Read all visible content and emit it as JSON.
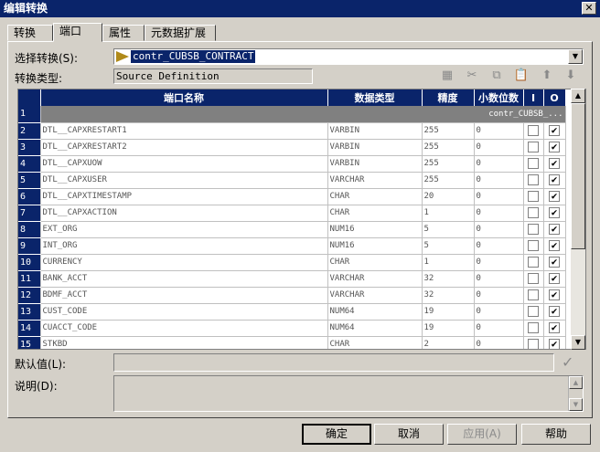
{
  "window": {
    "title": "编辑转换",
    "close_label": "✕"
  },
  "tabs": [
    {
      "label": "转换"
    },
    {
      "label": "端口"
    },
    {
      "label": "属性"
    },
    {
      "label": "元数据扩展"
    }
  ],
  "select_transform": {
    "label": "选择转换(S):",
    "value": "contr_CUBSB_CONTRACT"
  },
  "transform_type": {
    "label": "转换类型:",
    "value": "Source Definition"
  },
  "grid": {
    "headers": {
      "name": "端口名称",
      "datatype": "数据类型",
      "precision": "精度",
      "scale": "小数位数",
      "input": "I",
      "output": "O"
    },
    "group_row": {
      "num": "1",
      "text": "contr_CUBSB_..."
    },
    "rows": [
      {
        "num": "2",
        "name": "DTL__CAPXRESTART1",
        "type": "VARBIN",
        "prec": "255",
        "scale": "0",
        "i": false,
        "o": true
      },
      {
        "num": "3",
        "name": "DTL__CAPXRESTART2",
        "type": "VARBIN",
        "prec": "255",
        "scale": "0",
        "i": false,
        "o": true
      },
      {
        "num": "4",
        "name": "DTL__CAPXUOW",
        "type": "VARBIN",
        "prec": "255",
        "scale": "0",
        "i": false,
        "o": true
      },
      {
        "num": "5",
        "name": "DTL__CAPXUSER",
        "type": "VARCHAR",
        "prec": "255",
        "scale": "0",
        "i": false,
        "o": true
      },
      {
        "num": "6",
        "name": "DTL__CAPXTIMESTAMP",
        "type": "CHAR",
        "prec": "20",
        "scale": "0",
        "i": false,
        "o": true
      },
      {
        "num": "7",
        "name": "DTL__CAPXACTION",
        "type": "CHAR",
        "prec": "1",
        "scale": "0",
        "i": false,
        "o": true
      },
      {
        "num": "8",
        "name": "EXT_ORG",
        "type": "NUM16",
        "prec": "5",
        "scale": "0",
        "i": false,
        "o": true
      },
      {
        "num": "9",
        "name": "INT_ORG",
        "type": "NUM16",
        "prec": "5",
        "scale": "0",
        "i": false,
        "o": true
      },
      {
        "num": "10",
        "name": "CURRENCY",
        "type": "CHAR",
        "prec": "1",
        "scale": "0",
        "i": false,
        "o": true
      },
      {
        "num": "11",
        "name": "BANK_ACCT",
        "type": "VARCHAR",
        "prec": "32",
        "scale": "0",
        "i": false,
        "o": true
      },
      {
        "num": "12",
        "name": "BDMF_ACCT",
        "type": "VARCHAR",
        "prec": "32",
        "scale": "0",
        "i": false,
        "o": true
      },
      {
        "num": "13",
        "name": "CUST_CODE",
        "type": "NUM64",
        "prec": "19",
        "scale": "0",
        "i": false,
        "o": true
      },
      {
        "num": "14",
        "name": "CUACCT_CODE",
        "type": "NUM64",
        "prec": "19",
        "scale": "0",
        "i": false,
        "o": true
      },
      {
        "num": "15",
        "name": "STKBD",
        "type": "CHAR",
        "prec": "2",
        "scale": "0",
        "i": false,
        "o": true
      }
    ]
  },
  "default_value": {
    "label": "默认值(L):"
  },
  "description": {
    "label": "说明(D):"
  },
  "buttons": {
    "ok": "确定",
    "cancel": "取消",
    "apply": "应用(A)",
    "help": "帮助"
  }
}
